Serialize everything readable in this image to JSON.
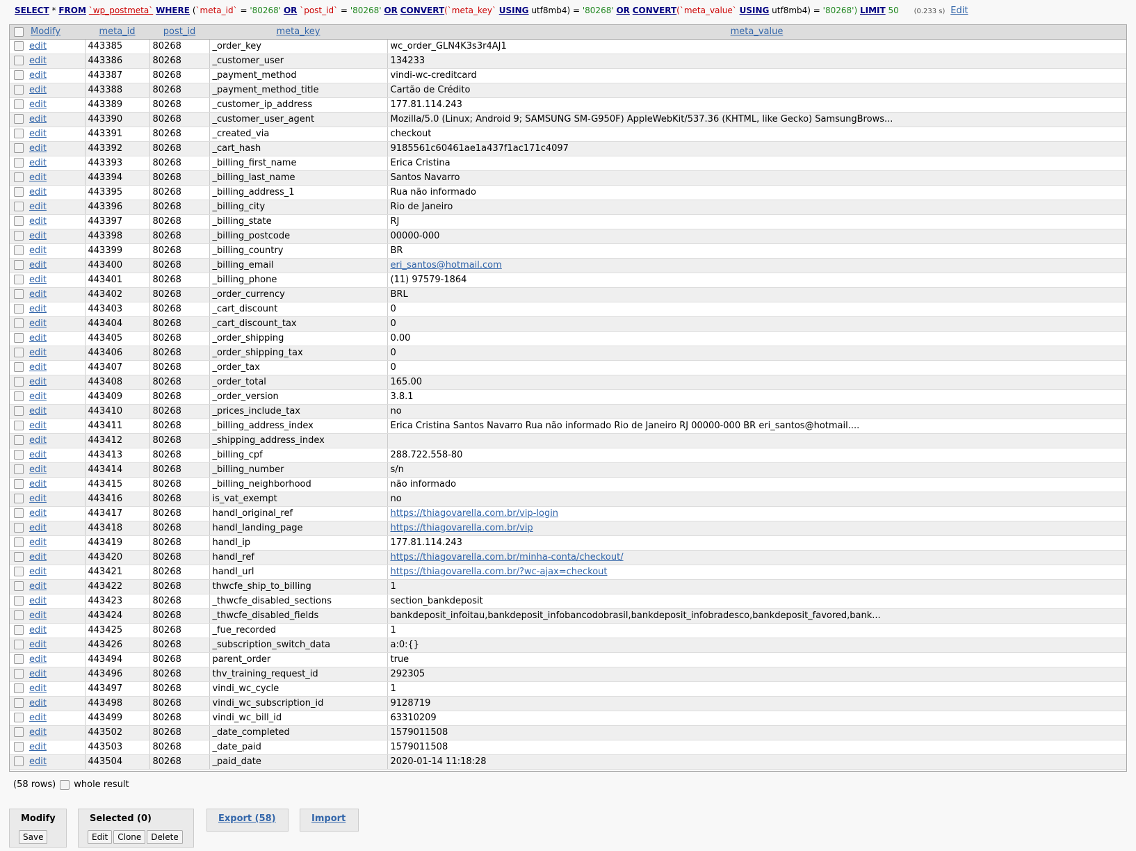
{
  "sql": {
    "select": "SELECT",
    "star": "*",
    "from": "FROM",
    "table": "`wp_postmeta`",
    "where": "WHERE",
    "open": "(",
    "c1": "`meta_id`",
    "eq1": "=",
    "v1": "'80268'",
    "or1": "OR",
    "c2": "`post_id`",
    "eq2": "=",
    "v2": "'80268'",
    "or2": "OR",
    "convert1": "CONVERT",
    "c3": "(`meta_key`",
    "using1": "USING",
    "enc1": "utf8mb4) =",
    "v3": "'80268'",
    "or3": "OR",
    "convert2": "CONVERT",
    "c4": "(`meta_value`",
    "using2": "USING",
    "enc2": "utf8mb4) =",
    "v4": "'80268')",
    "limit": "LIMIT",
    "limit_val": "50",
    "time": "(0.233 s)",
    "edit": "Edit"
  },
  "headers": {
    "modify": "Modify",
    "meta_id": "meta_id",
    "post_id": "post_id",
    "meta_key": "meta_key",
    "meta_value": "meta_value"
  },
  "edit_label": "edit",
  "rows": [
    {
      "meta_id": "443385",
      "post_id": "80268",
      "meta_key": "_order_key",
      "meta_value": "wc_order_GLN4K3s3r4AJ1"
    },
    {
      "meta_id": "443386",
      "post_id": "80268",
      "meta_key": "_customer_user",
      "meta_value": "134233"
    },
    {
      "meta_id": "443387",
      "post_id": "80268",
      "meta_key": "_payment_method",
      "meta_value": "vindi-wc-creditcard"
    },
    {
      "meta_id": "443388",
      "post_id": "80268",
      "meta_key": "_payment_method_title",
      "meta_value": "Cartão de Crédito"
    },
    {
      "meta_id": "443389",
      "post_id": "80268",
      "meta_key": "_customer_ip_address",
      "meta_value": "177.81.114.243"
    },
    {
      "meta_id": "443390",
      "post_id": "80268",
      "meta_key": "_customer_user_agent",
      "meta_value": "Mozilla/5.0 (Linux; Android 9; SAMSUNG SM-G950F) AppleWebKit/537.36 (KHTML, like Gecko) SamsungBrows..."
    },
    {
      "meta_id": "443391",
      "post_id": "80268",
      "meta_key": "_created_via",
      "meta_value": "checkout"
    },
    {
      "meta_id": "443392",
      "post_id": "80268",
      "meta_key": "_cart_hash",
      "meta_value": "9185561c60461ae1a437f1ac171c4097"
    },
    {
      "meta_id": "443393",
      "post_id": "80268",
      "meta_key": "_billing_first_name",
      "meta_value": "Erica Cristina"
    },
    {
      "meta_id": "443394",
      "post_id": "80268",
      "meta_key": "_billing_last_name",
      "meta_value": "Santos Navarro"
    },
    {
      "meta_id": "443395",
      "post_id": "80268",
      "meta_key": "_billing_address_1",
      "meta_value": "Rua não informado"
    },
    {
      "meta_id": "443396",
      "post_id": "80268",
      "meta_key": "_billing_city",
      "meta_value": "Rio de Janeiro"
    },
    {
      "meta_id": "443397",
      "post_id": "80268",
      "meta_key": "_billing_state",
      "meta_value": "RJ"
    },
    {
      "meta_id": "443398",
      "post_id": "80268",
      "meta_key": "_billing_postcode",
      "meta_value": "00000-000"
    },
    {
      "meta_id": "443399",
      "post_id": "80268",
      "meta_key": "_billing_country",
      "meta_value": "BR"
    },
    {
      "meta_id": "443400",
      "post_id": "80268",
      "meta_key": "_billing_email",
      "meta_value": "eri_santos@hotmail.com",
      "link": true
    },
    {
      "meta_id": "443401",
      "post_id": "80268",
      "meta_key": "_billing_phone",
      "meta_value": "(11) 97579-1864"
    },
    {
      "meta_id": "443402",
      "post_id": "80268",
      "meta_key": "_order_currency",
      "meta_value": "BRL"
    },
    {
      "meta_id": "443403",
      "post_id": "80268",
      "meta_key": "_cart_discount",
      "meta_value": "0"
    },
    {
      "meta_id": "443404",
      "post_id": "80268",
      "meta_key": "_cart_discount_tax",
      "meta_value": "0"
    },
    {
      "meta_id": "443405",
      "post_id": "80268",
      "meta_key": "_order_shipping",
      "meta_value": "0.00"
    },
    {
      "meta_id": "443406",
      "post_id": "80268",
      "meta_key": "_order_shipping_tax",
      "meta_value": "0"
    },
    {
      "meta_id": "443407",
      "post_id": "80268",
      "meta_key": "_order_tax",
      "meta_value": "0"
    },
    {
      "meta_id": "443408",
      "post_id": "80268",
      "meta_key": "_order_total",
      "meta_value": "165.00"
    },
    {
      "meta_id": "443409",
      "post_id": "80268",
      "meta_key": "_order_version",
      "meta_value": "3.8.1"
    },
    {
      "meta_id": "443410",
      "post_id": "80268",
      "meta_key": "_prices_include_tax",
      "meta_value": "no"
    },
    {
      "meta_id": "443411",
      "post_id": "80268",
      "meta_key": "_billing_address_index",
      "meta_value": "Erica Cristina Santos Navarro  Rua não informado  Rio de Janeiro RJ 00000-000 BR eri_santos@hotmail...."
    },
    {
      "meta_id": "443412",
      "post_id": "80268",
      "meta_key": "_shipping_address_index",
      "meta_value": ""
    },
    {
      "meta_id": "443413",
      "post_id": "80268",
      "meta_key": "_billing_cpf",
      "meta_value": "288.722.558-80"
    },
    {
      "meta_id": "443414",
      "post_id": "80268",
      "meta_key": "_billing_number",
      "meta_value": "s/n"
    },
    {
      "meta_id": "443415",
      "post_id": "80268",
      "meta_key": "_billing_neighborhood",
      "meta_value": "não informado"
    },
    {
      "meta_id": "443416",
      "post_id": "80268",
      "meta_key": "is_vat_exempt",
      "meta_value": "no"
    },
    {
      "meta_id": "443417",
      "post_id": "80268",
      "meta_key": "handl_original_ref",
      "meta_value": "https://thiagovarella.com.br/vip-login",
      "link": true
    },
    {
      "meta_id": "443418",
      "post_id": "80268",
      "meta_key": "handl_landing_page",
      "meta_value": "https://thiagovarella.com.br/vip",
      "link": true
    },
    {
      "meta_id": "443419",
      "post_id": "80268",
      "meta_key": "handl_ip",
      "meta_value": "177.81.114.243"
    },
    {
      "meta_id": "443420",
      "post_id": "80268",
      "meta_key": "handl_ref",
      "meta_value": "https://thiagovarella.com.br/minha-conta/checkout/",
      "link": true
    },
    {
      "meta_id": "443421",
      "post_id": "80268",
      "meta_key": "handl_url",
      "meta_value": "https://thiagovarella.com.br/?wc-ajax=checkout",
      "link": true
    },
    {
      "meta_id": "443422",
      "post_id": "80268",
      "meta_key": "thwcfe_ship_to_billing",
      "meta_value": "1"
    },
    {
      "meta_id": "443423",
      "post_id": "80268",
      "meta_key": "_thwcfe_disabled_sections",
      "meta_value": "section_bankdeposit"
    },
    {
      "meta_id": "443424",
      "post_id": "80268",
      "meta_key": "_thwcfe_disabled_fields",
      "meta_value": "bankdeposit_infoitau,bankdeposit_infobancodobrasil,bankdeposit_infobradesco,bankdeposit_favored,bank..."
    },
    {
      "meta_id": "443425",
      "post_id": "80268",
      "meta_key": "_fue_recorded",
      "meta_value": "1"
    },
    {
      "meta_id": "443426",
      "post_id": "80268",
      "meta_key": "_subscription_switch_data",
      "meta_value": "a:0:{}"
    },
    {
      "meta_id": "443494",
      "post_id": "80268",
      "meta_key": "parent_order",
      "meta_value": "true"
    },
    {
      "meta_id": "443496",
      "post_id": "80268",
      "meta_key": "thv_training_request_id",
      "meta_value": "292305"
    },
    {
      "meta_id": "443497",
      "post_id": "80268",
      "meta_key": "vindi_wc_cycle",
      "meta_value": "1"
    },
    {
      "meta_id": "443498",
      "post_id": "80268",
      "meta_key": "vindi_wc_subscription_id",
      "meta_value": "9128719"
    },
    {
      "meta_id": "443499",
      "post_id": "80268",
      "meta_key": "vindi_wc_bill_id",
      "meta_value": "63310209"
    },
    {
      "meta_id": "443502",
      "post_id": "80268",
      "meta_key": "_date_completed",
      "meta_value": "1579011508"
    },
    {
      "meta_id": "443503",
      "post_id": "80268",
      "meta_key": "_date_paid",
      "meta_value": "1579011508"
    },
    {
      "meta_id": "443504",
      "post_id": "80268",
      "meta_key": "_paid_date",
      "meta_value": "2020-01-14 11:18:28"
    }
  ],
  "footer": {
    "row_count": "(58 rows)",
    "whole_result": "whole result"
  },
  "modify_panel": {
    "title": "Modify",
    "save": "Save"
  },
  "selected_panel": {
    "title": "Selected (0)",
    "edit": "Edit",
    "clone": "Clone",
    "delete": "Delete"
  },
  "export_panel": {
    "title": "Export (58)"
  },
  "import_panel": {
    "title": "Import"
  }
}
